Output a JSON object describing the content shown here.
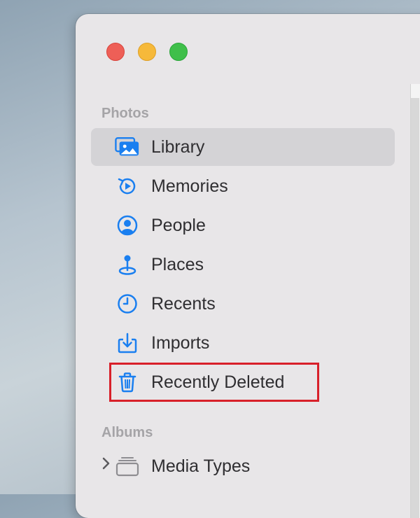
{
  "sidebar": {
    "photos_header": "Photos",
    "albums_header": "Albums",
    "items": [
      {
        "label": "Library",
        "icon": "library-icon"
      },
      {
        "label": "Memories",
        "icon": "memories-icon"
      },
      {
        "label": "People",
        "icon": "people-icon"
      },
      {
        "label": "Places",
        "icon": "places-icon"
      },
      {
        "label": "Recents",
        "icon": "recents-icon"
      },
      {
        "label": "Imports",
        "icon": "imports-icon"
      },
      {
        "label": "Recently Deleted",
        "icon": "trash-icon"
      }
    ],
    "albums": [
      {
        "label": "Media Types",
        "icon": "folder-stack-icon"
      }
    ]
  },
  "colors": {
    "accent": "#1a7ff0",
    "highlight": "#d8202a"
  }
}
